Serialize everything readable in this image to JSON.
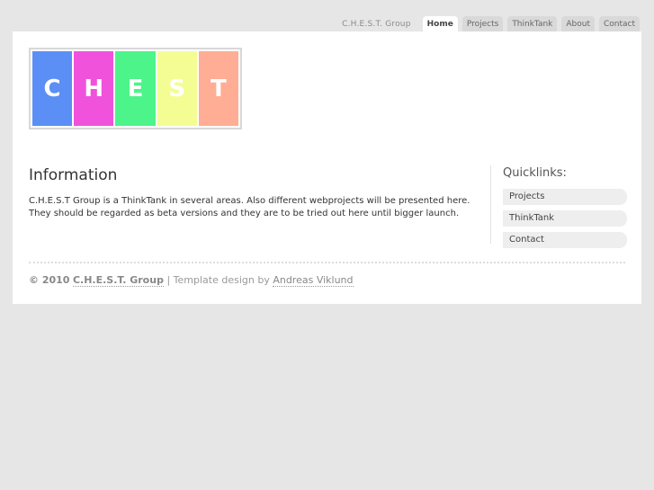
{
  "topnav": {
    "site_label": "C.H.E.S.T. Group",
    "tabs": [
      "Home",
      "Projects",
      "ThinkTank",
      "About",
      "Contact"
    ],
    "active": "Home"
  },
  "logo": {
    "letters": [
      "C",
      "H",
      "E",
      "S",
      "T"
    ],
    "colors": [
      "#5b8ff5",
      "#f152dc",
      "#4df48a",
      "#f4fd93",
      "#ffad94"
    ]
  },
  "main": {
    "heading": "Information",
    "body": "C.H.E.S.T Group is a ThinkTank in several areas. Also different webprojects will be presented here. They should be regarded as beta versions and they are to be tried out here until bigger launch."
  },
  "sidebar": {
    "heading": "Quicklinks:",
    "links": [
      "Projects",
      "ThinkTank",
      "Contact"
    ]
  },
  "footer": {
    "copyright": "© 2010",
    "group": "C.H.E.S.T. Group",
    "separator": "| Template design by",
    "author": "Andreas Viklund"
  }
}
